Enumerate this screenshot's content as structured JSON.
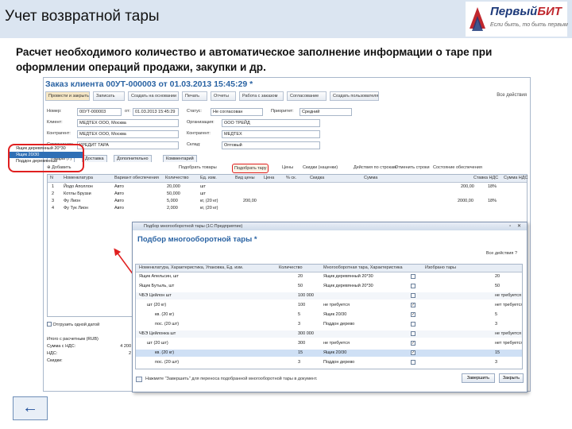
{
  "header": {
    "title": "Учет возвратной тары",
    "logo_name_a": "Первый",
    "logo_name_b": "БИТ",
    "logo_slogan": "Если быть, то быть первым"
  },
  "description": "Расчет необходимого количество и автоматическое заполнение информации о таре при оформлении операций продажи, закупки и др.",
  "order_window": {
    "title": "Заказ клиента 00УТ-000003 от 01.03.2013 15:45:29 *",
    "toolbar": [
      "Провести и закрыть",
      "Записать",
      "Создать на основании",
      "Печать",
      "Отчеты",
      "Работа с заказом",
      "Согласование",
      "Создать пользователя"
    ],
    "more": "Все действия",
    "fields": [
      {
        "label": "Номер:",
        "value": "00УТ-000003",
        "label2": "от:",
        "value2": "01.03.2013 15:45:29",
        "label3": "Статус:",
        "value3": "Не согласован",
        "label4": "Приоритет:",
        "value4": "Средний"
      },
      {
        "label": "Клиент:",
        "value": "МЕДТЕХ ООО, Москва",
        "label2": "",
        "value2": "",
        "label3": "Организация:",
        "value3": "ООО ТРЕЙД",
        "label4": "",
        "value4": ""
      },
      {
        "label": "Контрагент:",
        "value": "МЕДТЕХ ООО, Москва",
        "label2": "",
        "value2": "",
        "label3": "Контрагент:",
        "value3": "МЕДТЕХ",
        "label4": "",
        "value4": ""
      },
      {
        "label": "Соглашение:",
        "value": "КРЕДИТ ТАРА",
        "label2": "",
        "value2": "",
        "label3": "Склад:",
        "value3": "Оптовый",
        "label4": "",
        "value4": ""
      }
    ],
    "tabs": [
      "Товары (7)",
      "Доставка",
      "Дополнительно",
      "Комментарий"
    ],
    "grid_toolbar": [
      "Добавить",
      "Подобрать товары",
      "Подобрать тару",
      "Цены",
      "Скидки (наценки)",
      "Действия по строкам",
      "Отменить строки",
      "Состояние обеспечения"
    ],
    "grid_toolbar_highlight_index": 2,
    "grid_headers": [
      "N",
      "Номенклатура",
      "Вариант обеспечения",
      "Количество",
      "Ед. изм.",
      "Вид цены",
      "Цена",
      "% ск.",
      "Скидка",
      "Сумма",
      "Ставка НДС",
      "Сумма НДС"
    ],
    "rows": [
      {
        "n": "1",
        "name": "Йодо Аполлон",
        "variant": "Авто",
        "qty": "20,000",
        "unit": "шт",
        "price": "",
        "sum": "200,00",
        "vat": "18%"
      },
      {
        "n": "2",
        "name": "Котлы Бруззи",
        "variant": "Авто",
        "qty": "50,000",
        "unit": "шт",
        "price": "",
        "sum": "",
        "vat": ""
      },
      {
        "n": "3",
        "name": "Фу Лион",
        "variant": "Авто",
        "qty": "5,000",
        "unit": "кг, (20 кг)",
        "price": "200,00",
        "sum": "2000,00",
        "vat": "18%"
      },
      {
        "n": "4",
        "name": "Фу Тук Лион",
        "variant": "Авто",
        "qty": "2,000",
        "unit": "кг, (20 кг)",
        "price": "",
        "sum": "",
        "vat": ""
      }
    ],
    "selected_items": [
      "Ящик деревянный 20*30",
      "Ящик 20/30",
      "Поддон деревянный"
    ],
    "split_label": "Отгрузить одной датой",
    "totals": [
      {
        "label": "Итого с расчетным (RUB)",
        "value": ""
      },
      {
        "label": "Сумма с НДС:",
        "value": "4 200"
      },
      {
        "label": "НДС:",
        "value": "2"
      },
      {
        "label": "Скидки:",
        "value": ""
      }
    ]
  },
  "dialog": {
    "bar_title": "Подбор многооборотной тары (1С:Предприятие)",
    "title": "Подбор многооборотной тары *",
    "actions": "Все действия",
    "headers": [
      "Номенклатура, Характеристика, Упаковка, Ед. изм.",
      "Количество",
      "Многооборотная тара, Характеристика",
      "Изобрано тары"
    ],
    "rows": [
      {
        "level": 0,
        "name": "Ящик Апельсин, шт",
        "qty": "20",
        "tare": "Ящик деревянный 20*30",
        "check": false,
        "count": "20"
      },
      {
        "level": 0,
        "name": "Ящик Бутыль, шт",
        "qty": "50",
        "tare": "Ящик деревянный 20*30",
        "check": false,
        "count": "50"
      },
      {
        "level": 0,
        "name": "ЧБЭ Цейлон шт",
        "qty": "100 000",
        "tare": "",
        "check": false,
        "count": "не требуется",
        "group": true
      },
      {
        "level": 1,
        "name": "шт (20 кг)",
        "qty": "100",
        "tare": "не требуется",
        "check": true,
        "count": "нет требуется"
      },
      {
        "level": 2,
        "name": "кв. (20 кг)",
        "qty": "5",
        "tare": "Ящик 20/30",
        "check": true,
        "count": "5"
      },
      {
        "level": 2,
        "name": "пос. (20 шт)",
        "qty": "3",
        "tare": "Поддон дерево",
        "check": false,
        "count": "3"
      },
      {
        "level": 0,
        "name": "ЧБЭ Цейлонка шт",
        "qty": "300 000",
        "tare": "",
        "check": false,
        "count": "не требуется",
        "group": true
      },
      {
        "level": 1,
        "name": "шт (20 шт)",
        "qty": "300",
        "tare": "не требуется",
        "check": true,
        "count": "нет требуется"
      },
      {
        "level": 2,
        "name": "кв. (20 кг)",
        "qty": "15",
        "tare": "Ящик 20/30",
        "check": true,
        "count": "15",
        "selected": true
      },
      {
        "level": 2,
        "name": "пос. (20 шт)",
        "qty": "3",
        "tare": "Поддон дерево",
        "check": false,
        "count": "3"
      }
    ],
    "hint": "Нажмите \"Завершить\" для переноса подобранной многооборотной тары в документ.",
    "finish_label": "Завершить",
    "close_label": "Закрыть",
    "help_label": "?"
  },
  "nav": {
    "back_label": "←"
  }
}
